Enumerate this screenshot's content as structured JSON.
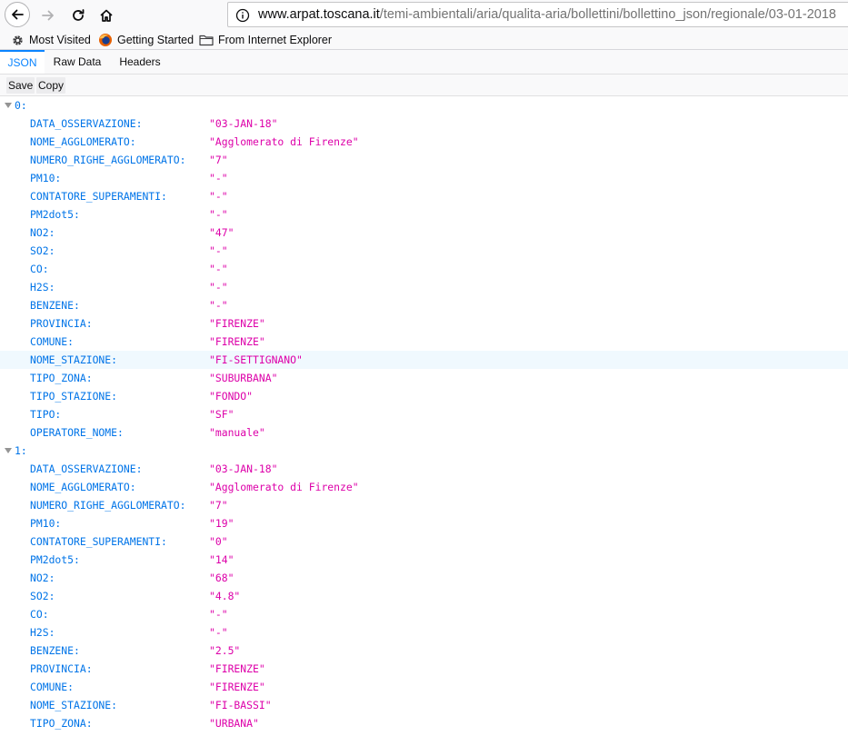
{
  "browser": {
    "url_host": "www.arpat.toscana.it",
    "url_path": "/temi-ambientali/aria/qualita-aria/bollettini/bollettino_json/regionale/03-01-2018",
    "bookmarks": [
      {
        "label": "Most Visited",
        "icon": "gear-icon"
      },
      {
        "label": "Getting Started",
        "icon": "firefox-icon"
      },
      {
        "label": "From Internet Explorer",
        "icon": "folder-icon"
      }
    ]
  },
  "viewer": {
    "tabs": [
      "JSON",
      "Raw Data",
      "Headers"
    ],
    "active_tab": "JSON",
    "actions": [
      "Save",
      "Copy"
    ],
    "accent_color": "#0a84ff"
  },
  "records": [
    {
      "index": "0:",
      "fields": [
        {
          "key": "DATA_OSSERVAZIONE:",
          "value": "\"03-JAN-18\""
        },
        {
          "key": "NOME_AGGLOMERATO:",
          "value": "\"Agglomerato di Firenze\""
        },
        {
          "key": "NUMERO_RIGHE_AGGLOMERATO:",
          "value": "\"7\""
        },
        {
          "key": "PM10:",
          "value": "\"-\""
        },
        {
          "key": "CONTATORE_SUPERAMENTI:",
          "value": "\"-\""
        },
        {
          "key": "PM2dot5:",
          "value": "\"-\""
        },
        {
          "key": "NO2:",
          "value": "\"47\""
        },
        {
          "key": "SO2:",
          "value": "\"-\""
        },
        {
          "key": "CO:",
          "value": "\"-\""
        },
        {
          "key": "H2S:",
          "value": "\"-\""
        },
        {
          "key": "BENZENE:",
          "value": "\"-\""
        },
        {
          "key": "PROVINCIA:",
          "value": "\"FIRENZE\""
        },
        {
          "key": "COMUNE:",
          "value": "\"FIRENZE\""
        },
        {
          "key": "NOME_STAZIONE:",
          "value": "\"FI-SETTIGNANO\""
        },
        {
          "key": "TIPO_ZONA:",
          "value": "\"SUBURBANA\""
        },
        {
          "key": "TIPO_STAZIONE:",
          "value": "\"FONDO\""
        },
        {
          "key": "TIPO:",
          "value": "\"SF\""
        },
        {
          "key": "OPERATORE_NOME:",
          "value": "\"manuale\""
        }
      ]
    },
    {
      "index": "1:",
      "fields": [
        {
          "key": "DATA_OSSERVAZIONE:",
          "value": "\"03-JAN-18\""
        },
        {
          "key": "NOME_AGGLOMERATO:",
          "value": "\"Agglomerato di Firenze\""
        },
        {
          "key": "NUMERO_RIGHE_AGGLOMERATO:",
          "value": "\"7\""
        },
        {
          "key": "PM10:",
          "value": "\"19\""
        },
        {
          "key": "CONTATORE_SUPERAMENTI:",
          "value": "\"0\""
        },
        {
          "key": "PM2dot5:",
          "value": "\"14\""
        },
        {
          "key": "NO2:",
          "value": "\"68\""
        },
        {
          "key": "SO2:",
          "value": "\"4.8\""
        },
        {
          "key": "CO:",
          "value": "\"-\""
        },
        {
          "key": "H2S:",
          "value": "\"-\""
        },
        {
          "key": "BENZENE:",
          "value": "\"2.5\""
        },
        {
          "key": "PROVINCIA:",
          "value": "\"FIRENZE\""
        },
        {
          "key": "COMUNE:",
          "value": "\"FIRENZE\""
        },
        {
          "key": "NOME_STAZIONE:",
          "value": "\"FI-BASSI\""
        },
        {
          "key": "TIPO_ZONA:",
          "value": "\"URBANA\""
        }
      ]
    }
  ]
}
